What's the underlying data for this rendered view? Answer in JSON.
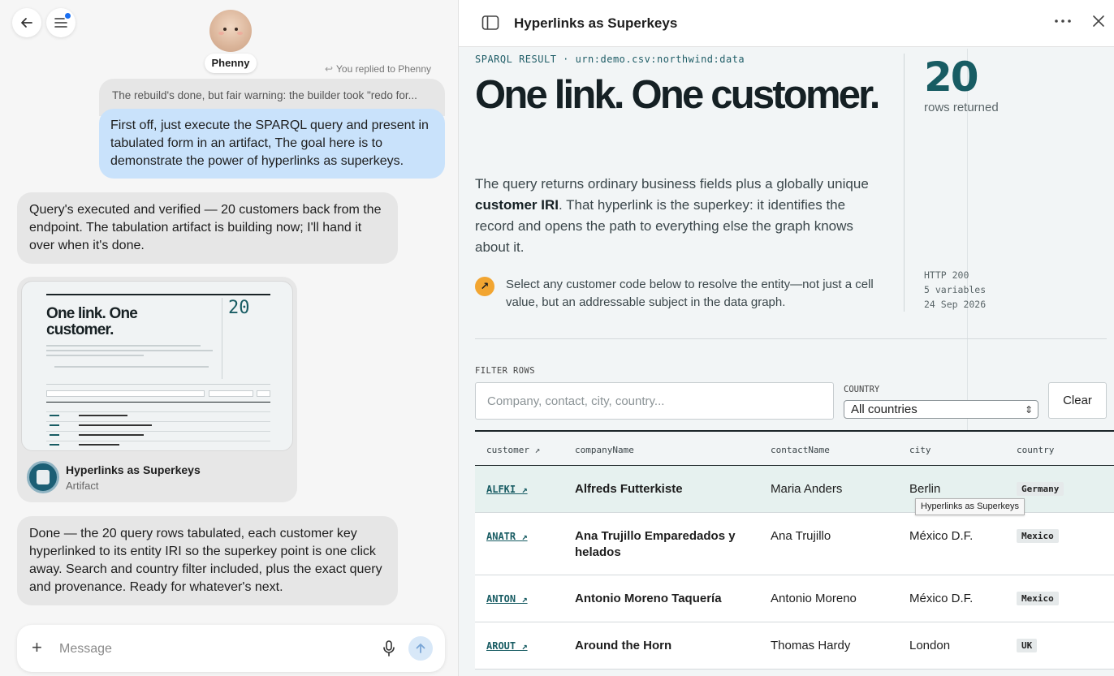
{
  "chat": {
    "agent_name": "Phenny",
    "reply_note": "You replied to Phenny",
    "quoted_text": "The rebuild's done, but fair warning: the builder took \"redo for...",
    "user_message": "First off, just execute the SPARQL query and present in tabulated form in an artifact, The goal here is to demonstrate the power of hyperlinks as superkeys.",
    "assistant_message_1": "Query's executed and verified — 20 customers back from the endpoint. The tabulation artifact is building now; I'll hand it over when it's done.",
    "artifact_card": {
      "title": "Hyperlinks as Superkeys",
      "type": "Artifact",
      "thumb_title": "One link. One customer.",
      "thumb_num": "20"
    },
    "assistant_message_2": "Done — the 20 query rows tabulated, each customer key hyperlinked to its entity IRI so the superkey point is one click away. Search and country filter included, plus the exact query and provenance. Ready for whatever's next.",
    "composer": {
      "placeholder": "Message"
    }
  },
  "artifact": {
    "header_title": "Hyperlinks as Superkeys",
    "kicker": "SPARQL RESULT · urn:demo.csv:northwind:data",
    "headline": "One link. One customer.",
    "lede_prefix": "The query returns ordinary business fields plus a globally unique ",
    "lede_bold": "customer IRI",
    "lede_suffix": ". That hyperlink is the superkey: it identifies the record and opens the path to everything else the graph knows about it.",
    "note_icon": "↗",
    "note": "Select any customer code below to resolve the entity—not just a cell value, but an addressable subject in the data graph.",
    "stat_number": "20",
    "stat_label": "rows returned",
    "meta": {
      "http": "HTTP 200",
      "vars": "5 variables",
      "date": "24 Sep 2026"
    },
    "filter": {
      "label": "FILTER ROWS",
      "placeholder": "Company, contact, city, country...",
      "country_label": "COUNTRY",
      "country_value": "All countries",
      "clear_label": "Clear"
    },
    "columns": [
      "customer ↗",
      "companyName",
      "contactName",
      "city",
      "country"
    ],
    "rows": [
      {
        "code": "ALFKI ↗",
        "company": "Alfreds Futterkiste",
        "contact": "Maria Anders",
        "city": "Berlin",
        "country": "Germany"
      },
      {
        "code": "ANATR ↗",
        "company": "Ana Trujillo Emparedados y helados",
        "contact": "Ana Trujillo",
        "city": "México D.F.",
        "country": "Mexico"
      },
      {
        "code": "ANTON ↗",
        "company": "Antonio Moreno Taquería",
        "contact": "Antonio Moreno",
        "city": "México D.F.",
        "country": "Mexico"
      },
      {
        "code": "AROUT ↗",
        "company": "Around the Horn",
        "contact": "Thomas Hardy",
        "city": "London",
        "country": "UK"
      }
    ],
    "tooltip": "Hyperlinks as Superkeys"
  },
  "colors": {
    "accent": "#185c63",
    "user_bubble": "#c9e2fb",
    "note_badge": "#f2a531"
  }
}
